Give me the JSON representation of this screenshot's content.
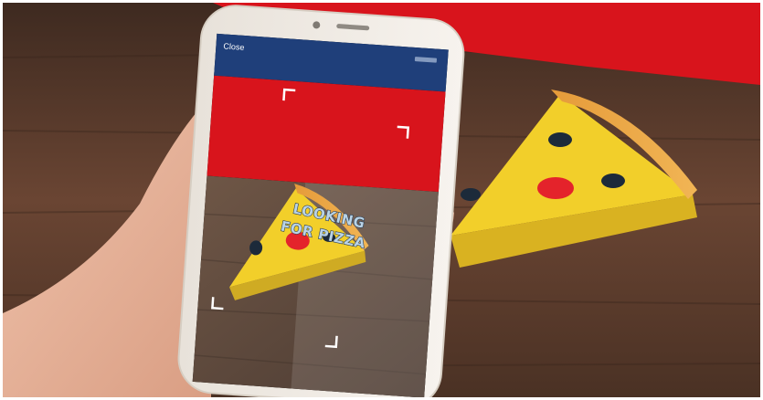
{
  "app": {
    "close_label": "Close",
    "overlay_text_line1": "LOOKING",
    "overlay_text_line2": "FOR PIZZA"
  },
  "colors": {
    "header_bar": "#1f3f7a",
    "table_wood": "#5a3b2a",
    "red_background": "#d8141c",
    "pizza_yellow": "#f2cf2a",
    "pepperoni": "#e4232b"
  },
  "icons": [
    "scan-corner-icon",
    "status-icons"
  ]
}
